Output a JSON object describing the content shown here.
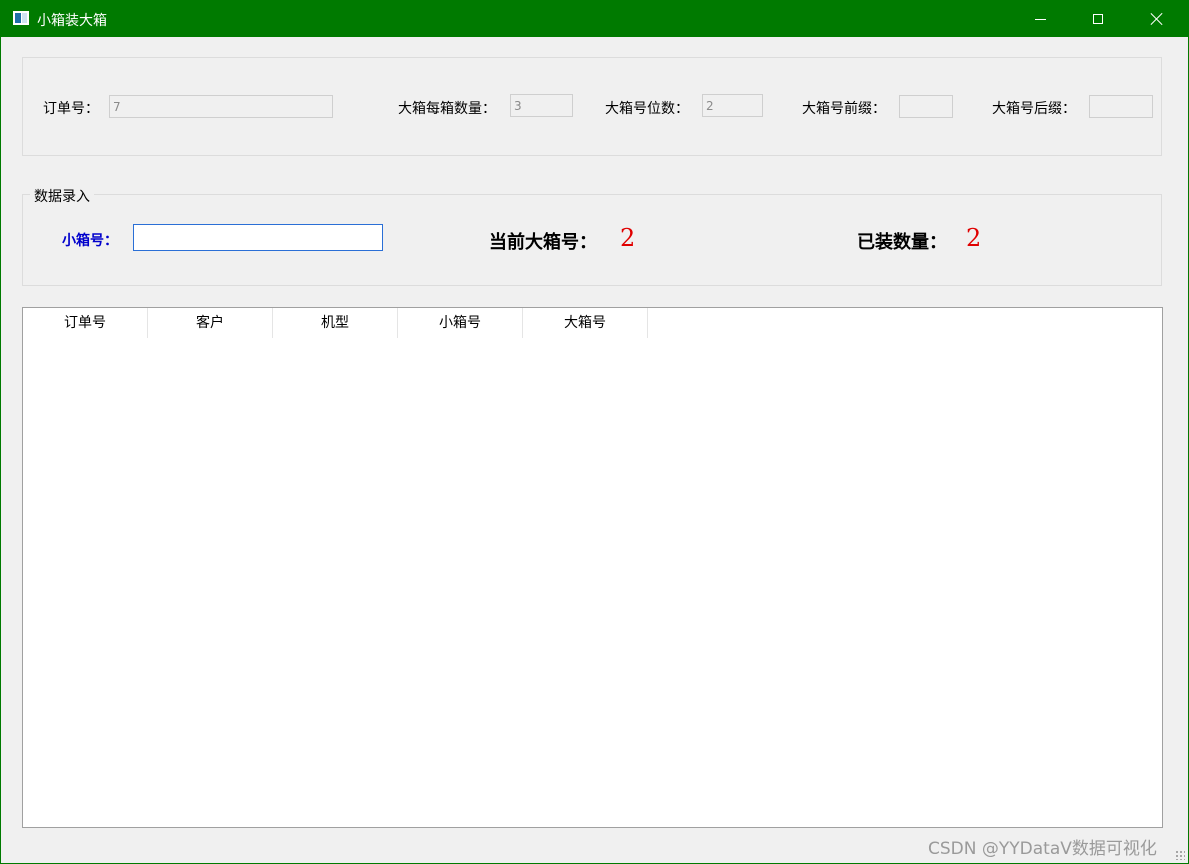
{
  "window": {
    "title": "小箱装大箱",
    "accent_color": "#007a00",
    "controls": {
      "minimize": "minimize-icon",
      "maximize": "maximize-icon",
      "close": "close-icon"
    }
  },
  "config": {
    "order_label": "订单号：",
    "order_value": "7",
    "per_box_label": "大箱每箱数量：",
    "per_box_value": "3",
    "digits_label": "大箱号位数：",
    "digits_value": "2",
    "prefix_label": "大箱号前缀：",
    "prefix_value": "",
    "suffix_label": "大箱号后缀：",
    "suffix_value": ""
  },
  "entry": {
    "group_title": "数据录入",
    "small_box_label": "小箱号：",
    "small_box_value": "",
    "current_big_box_label": "当前大箱号：",
    "current_big_box_value": "2",
    "packed_count_label": "已装数量：",
    "packed_count_value": "2",
    "value_color": "#e00000"
  },
  "table": {
    "columns": [
      "订单号",
      "客户",
      "机型",
      "小箱号",
      "大箱号"
    ],
    "rows": []
  },
  "watermark": "CSDN @YYDataV数据可视化"
}
